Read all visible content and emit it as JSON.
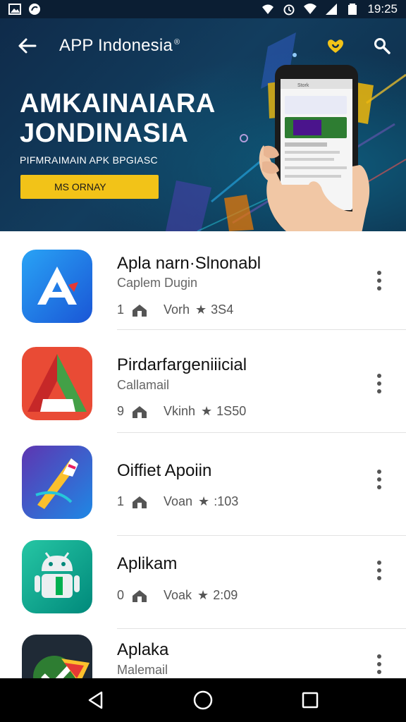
{
  "status_bar": {
    "time": "19:25",
    "icons": [
      "image-icon",
      "notification-icon",
      "wifi-icon",
      "alarm-icon",
      "signal-icon",
      "battery-icon"
    ]
  },
  "app_bar": {
    "title": "APP Indonesia",
    "back_icon": "arrow-back-icon",
    "actions": [
      "badge-icon",
      "search-icon"
    ]
  },
  "hero": {
    "headline_line1": "AMKAINAIARA",
    "headline_line2": "JONDINASIA",
    "subtitle": "PIFMRAIMAIN APK BPGIASC",
    "cta_label": "MS ORNAY",
    "cta_color": "#f2c318",
    "phone_screen_title": "Stork"
  },
  "apps": [
    {
      "name": "Apla narn·Slnonabl",
      "developer": "Caplem Dugin",
      "count": "1",
      "label": "Vorh",
      "rating": "3S4"
    },
    {
      "name": "Pirdarfargeniiicial",
      "developer": "Callamail",
      "count": "9",
      "label": "Vkinh",
      "rating": "1S50"
    },
    {
      "name": "Oiffiet Apoiin",
      "developer": "",
      "count": "1",
      "label": "Voan",
      "rating": ":103"
    },
    {
      "name": "Aplikam",
      "developer": "",
      "count": "0",
      "label": "Voak",
      "rating": "2:09"
    },
    {
      "name": "Aplaka",
      "developer": "Malemail",
      "count": "",
      "label": "",
      "rating": ""
    }
  ],
  "nav_bar": {
    "buttons": [
      "back-triangle-icon",
      "home-circle-icon",
      "recents-square-icon"
    ]
  },
  "colors": {
    "hero_bg": "#0f2b4a",
    "accent": "#f2c318",
    "status_bar": "#0b1e33"
  }
}
